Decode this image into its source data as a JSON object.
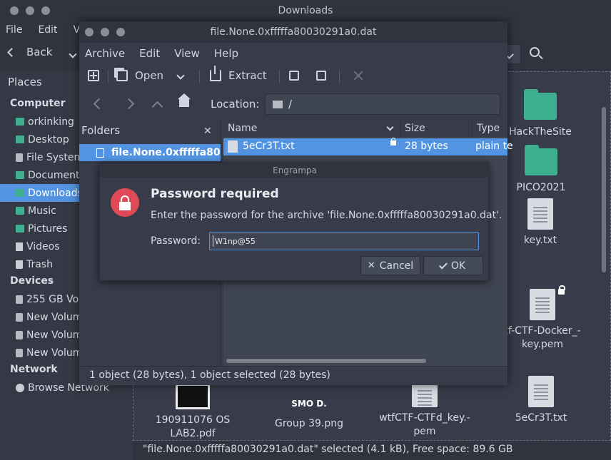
{
  "file_manager": {
    "window_title": "Downloads",
    "menu": [
      "File",
      "Edit",
      "Vie"
    ],
    "back_label": "Back",
    "places_heading": "Places",
    "sections": {
      "computer": "Computer",
      "devices": "Devices",
      "network": "Network"
    },
    "computer_items": [
      "orkinking",
      "Desktop",
      "File System",
      "Documents",
      "Downloads",
      "Music",
      "Pictures",
      "Videos",
      "Trash"
    ],
    "device_items": [
      "255 GB Vol",
      "New Volum",
      "New Volum",
      "New Volum"
    ],
    "network_items": [
      "Browse Network"
    ],
    "files": {
      "hackthesite": "HackTheSite",
      "pico": "PICO2021",
      "key": "key.txt",
      "docker_key_l1": "tf-CTF-Docker_-",
      "docker_key_l2": "key.pem",
      "lab2_l1": "190911076 OS",
      "lab2_l2": "LAB2.pdf",
      "group39_thumb": "SMO D.",
      "group39": "Group 39.png",
      "ctfd_l1": "wtfCTF-CTFd_key.-",
      "ctfd_l2": "pem",
      "secret": "5eCr3T.txt"
    },
    "status": "\"file.None.0xfffffa80030291a0.dat\" selected (4.1 kB), Free space: 89.6 GB"
  },
  "archive_manager": {
    "window_title": "file.None.0xfffffa80030291a0.dat",
    "menu": [
      "Archive",
      "Edit",
      "View",
      "Help"
    ],
    "toolbar": {
      "open": "Open",
      "extract": "Extract"
    },
    "location_label": "Location:",
    "location_value": "/",
    "folders_heading": "Folders",
    "folder_item": "file.None.0xfffffa80...",
    "columns": [
      "Name",
      "Size",
      "Type"
    ],
    "rows": [
      {
        "name": "5eCr3T.txt",
        "size": "28 bytes",
        "type": "plain te"
      }
    ],
    "status": "1 object (28 bytes), 1 object selected (28 bytes)"
  },
  "dialog": {
    "title": "Engrampa",
    "heading": "Password required",
    "message": "Enter the password for the archive 'file.None.0xfffffa80030291a0.dat'.",
    "password_label": "Password:",
    "password_value": "W1np@55",
    "cancel_label": "Cancel",
    "ok_label": "OK"
  },
  "colors": {
    "accent": "#5294e2",
    "folder": "#3fb08f",
    "alert": "#e04a57"
  }
}
